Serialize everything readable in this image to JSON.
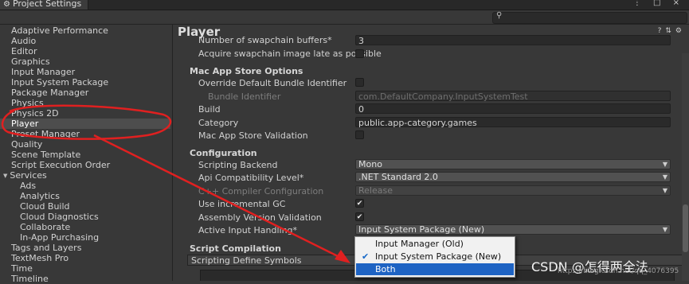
{
  "window": {
    "title": "Project Settings",
    "controls": "⋮ □ ×"
  },
  "sidebar": {
    "items": [
      {
        "label": "Adaptive Performance"
      },
      {
        "label": "Audio"
      },
      {
        "label": "Editor"
      },
      {
        "label": "Graphics"
      },
      {
        "label": "Input Manager"
      },
      {
        "label": "Input System Package"
      },
      {
        "label": "Package Manager"
      },
      {
        "label": "Physics"
      },
      {
        "label": "Physics 2D"
      },
      {
        "label": "Player"
      },
      {
        "label": "Preset Manager"
      },
      {
        "label": "Quality"
      },
      {
        "label": "Scene Template"
      },
      {
        "label": "Script Execution Order"
      },
      {
        "label": "Services"
      },
      {
        "label": "Ads"
      },
      {
        "label": "Analytics"
      },
      {
        "label": "Cloud Build"
      },
      {
        "label": "Cloud Diagnostics"
      },
      {
        "label": "Collaborate"
      },
      {
        "label": "In-App Purchasing"
      },
      {
        "label": "Tags and Layers"
      },
      {
        "label": "TextMesh Pro"
      },
      {
        "label": "Time"
      },
      {
        "label": "Timeline"
      }
    ]
  },
  "main": {
    "title": "Player",
    "rows": {
      "swapchain_buffers": {
        "label": "Number of swapchain buffers*",
        "value": "3"
      },
      "acquire_late": {
        "label": "Acquire swapchain image late as possible"
      },
      "mac_section": "Mac App Store Options",
      "override_bundle": {
        "label": "Override Default Bundle Identifier"
      },
      "bundle_identifier": {
        "label": "Bundle Identifier",
        "value": "com.DefaultCompany.InputSystemTest"
      },
      "build": {
        "label": "Build",
        "value": "0"
      },
      "category": {
        "label": "Category",
        "value": "public.app-category.games"
      },
      "mac_validation": {
        "label": "Mac App Store Validation"
      },
      "config_section": "Configuration",
      "scripting_backend": {
        "label": "Scripting Backend",
        "value": "Mono"
      },
      "api_level": {
        "label": "Api Compatibility Level*",
        "value": ".NET Standard 2.0"
      },
      "cpp_config": {
        "label": "C++ Compiler Configuration",
        "value": "Release"
      },
      "incremental_gc": {
        "label": "Use incremental GC"
      },
      "assembly_validation": {
        "label": "Assembly Version Validation"
      },
      "active_input": {
        "label": "Active Input Handling*",
        "value": "Input System Package (New)"
      },
      "script_compilation": "Script Compilation",
      "define_symbols": {
        "label": "Scripting Define Symbols"
      }
    }
  },
  "popup": {
    "options": [
      {
        "label": "Input Manager (Old)"
      },
      {
        "label": "Input System Package (New)",
        "check": "✔"
      },
      {
        "label": "Both"
      }
    ]
  },
  "watermark": {
    "text": "CSDN @怎得两全法",
    "url": "https://blog.csdn.net/qq_4076395"
  },
  "colors": {
    "annotation": "#e02020",
    "highlight": "#1e63c3",
    "checkmark": "#1668c8"
  }
}
